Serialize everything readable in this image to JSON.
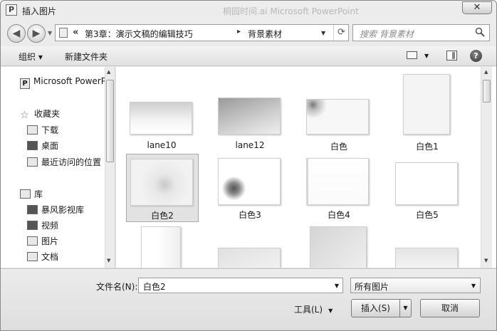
{
  "window": {
    "title": "插入图片",
    "background_app_title": "桐园时间.ai    Microsoft PowerPoint",
    "close_label": "✕",
    "app_icon_letter": "P"
  },
  "address": {
    "prefix": "«",
    "crumbs": [
      "第3章：演示文稿的编辑技巧",
      "背景素材"
    ],
    "crumb_separator": "▸"
  },
  "search": {
    "placeholder": "搜索 背景素材"
  },
  "toolbar": {
    "organize": "组织 ▾",
    "new_folder": "新建文件夹"
  },
  "nav_pane": {
    "items": [
      {
        "label": "Microsoft PowerPoint",
        "icon": "powerpoint-icon"
      },
      {
        "label": "收藏夹",
        "icon": "star-icon"
      },
      {
        "label": "下载",
        "icon": "download-icon"
      },
      {
        "label": "桌面",
        "icon": "desktop-icon"
      },
      {
        "label": "最近访问的位置",
        "icon": "recent-places-icon"
      },
      {
        "label": "库",
        "icon": "library-icon"
      },
      {
        "label": "暴风影视库",
        "icon": "video-library-icon"
      },
      {
        "label": "视频",
        "icon": "video-icon"
      },
      {
        "label": "图片",
        "icon": "pictures-icon"
      },
      {
        "label": "文档",
        "icon": "document-icon"
      }
    ]
  },
  "files": [
    {
      "name": "lane10"
    },
    {
      "name": "lane12"
    },
    {
      "name": "白色"
    },
    {
      "name": "白色1"
    },
    {
      "name": "白色2",
      "selected": true
    },
    {
      "name": "白色3"
    },
    {
      "name": "白色4"
    },
    {
      "name": "白色5"
    }
  ],
  "bottom": {
    "filename_label": "文件名(N):",
    "filename_value": "白色2",
    "filetype_value": "所有图片",
    "tools_label": "工具(L)",
    "insert_label": "插入(S)",
    "cancel_label": "取消"
  }
}
